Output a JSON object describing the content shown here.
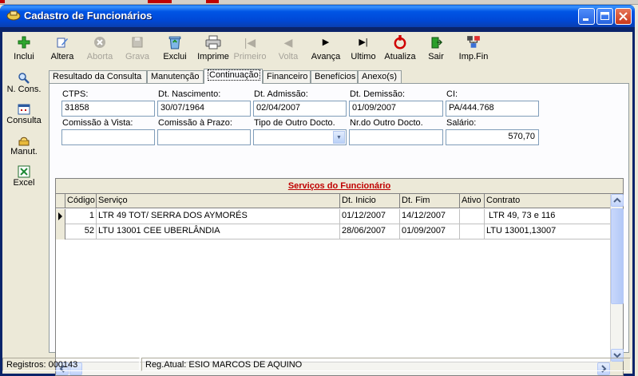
{
  "window": {
    "title": "Cadastro de Funcionários"
  },
  "toolbar": {
    "buttons": [
      {
        "label": "Inclui",
        "icon": "plus-icon"
      },
      {
        "label": "Altera",
        "icon": "edit-icon"
      },
      {
        "label": "Aborta",
        "icon": "cancel-icon"
      },
      {
        "label": "Grava",
        "icon": "save-icon"
      },
      {
        "label": "Exclui",
        "icon": "recycle-bin-icon"
      },
      {
        "label": "Imprime",
        "icon": "printer-icon"
      },
      {
        "label": "Primeiro",
        "icon": "first-record-icon"
      },
      {
        "label": "Volta",
        "icon": "previous-record-icon"
      },
      {
        "label": "Avança",
        "icon": "next-record-icon"
      },
      {
        "label": "Ultimo",
        "icon": "last-record-icon"
      },
      {
        "label": "Atualiza",
        "icon": "refresh-icon"
      },
      {
        "label": "Sair",
        "icon": "exit-icon"
      },
      {
        "label": "Imp.Fin",
        "icon": "network-print-icon"
      }
    ]
  },
  "leftnav": {
    "items": [
      {
        "label": "N. Cons.",
        "icon": "magnifier-icon"
      },
      {
        "label": "Consulta",
        "icon": "consulta-icon"
      },
      {
        "label": "Manut.",
        "icon": "maintenance-icon"
      },
      {
        "label": "Excel",
        "icon": "excel-icon"
      }
    ]
  },
  "tabs": [
    "Resultado da Consulta",
    "Manutenção",
    "Continuação",
    "Financeiro",
    "Benefícios",
    "Anexo(s)"
  ],
  "active_tab": "Continuação",
  "form": {
    "ctps": {
      "label": "CTPS:",
      "value": "31858"
    },
    "dt_nascimento": {
      "label": "Dt. Nascimento:",
      "value": "30/07/1964"
    },
    "dt_admissao": {
      "label": "Dt. Admissão:",
      "value": "02/04/2007"
    },
    "dt_demissao": {
      "label": "Dt. Demissão:",
      "value": "01/09/2007"
    },
    "ci": {
      "label": "CI:",
      "value": "PA/444.768"
    },
    "comissao_vista": {
      "label": "Comissão à Vista:",
      "value": ""
    },
    "comissao_prazo": {
      "label": "Comissão à Prazo:",
      "value": ""
    },
    "tipo_outro_docto": {
      "label": "Tipo de Outro Docto.",
      "value": ""
    },
    "nr_outro_docto": {
      "label": "Nr.do Outro Docto.",
      "value": ""
    },
    "salario": {
      "label": "Salário:",
      "value": "570,70"
    }
  },
  "grid": {
    "title": "Serviços do Funcionário",
    "columns": [
      "Código",
      "Serviço",
      "Dt. Inicio",
      "Dt. Fim",
      "Ativo",
      "Contrato"
    ],
    "rows": [
      {
        "codigo": "1",
        "servico": "LTR 49 TOT/ SERRA DOS AYMORÉS",
        "dt_inicio": "01/12/2007",
        "dt_fim": "14/12/2007",
        "ativo": "",
        "contrato": " LTR 49, 73 e 116"
      },
      {
        "codigo": "52",
        "servico": "LTU 13001 CEE UBERLÂNDIA",
        "dt_inicio": "28/06/2007",
        "dt_fim": "01/09/2007",
        "ativo": "",
        "contrato": "LTU 13001,13007"
      }
    ]
  },
  "status": {
    "registros": "Registros: 000143",
    "reg_atual": "Reg.Atual: ESIO MARCOS DE AQUINO"
  }
}
